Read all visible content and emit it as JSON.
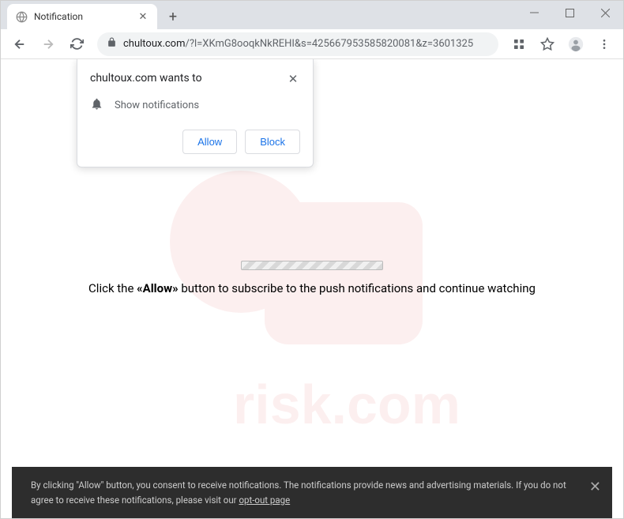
{
  "tab": {
    "title": "Notification"
  },
  "url": {
    "domain": "chultoux.com",
    "path": "/?l=XKmG8ooqkNkREHI&s=425667953585820081&z=3601325"
  },
  "popup": {
    "title": "chultoux.com wants to",
    "body": "Show notifications",
    "allow": "Allow",
    "block": "Block"
  },
  "instruction": {
    "prefix": "Click the ",
    "bold": "«Allow»",
    "suffix": " button to subscribe to the push notifications and continue watching"
  },
  "cookie": {
    "text": "By clicking \"Allow\" button, you consent to receive notifications. The notifications provide news and advertising materials. If you do not agree to receive these notifications, please visit our ",
    "link": "opt-out page"
  }
}
